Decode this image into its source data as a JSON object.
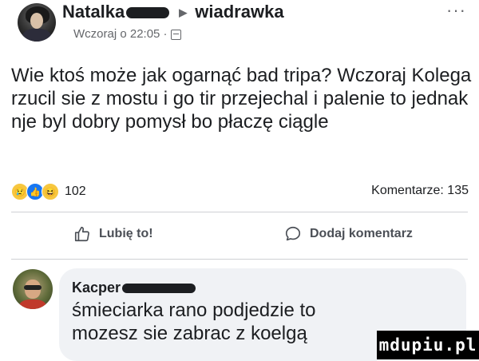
{
  "post": {
    "author": "Natalka",
    "group": "wiadrawka",
    "timestamp": "Wczoraj o 22:05 ·",
    "more_label": "···",
    "text": "Wie ktoś może jak ogarnąć bad tripa? Wczoraj Kolega rzucil sie z mostu i go tir przejechal i palenie to jednak nje byl dobry pomysł bo płaczę ciągle",
    "reaction_count": "102",
    "comments_count": "Komentarze: 135"
  },
  "actions": {
    "like_label": "Lubię to!",
    "comment_label": "Dodaj komentarz"
  },
  "comment": {
    "author": "Kacper",
    "text": "śmieciarka rano podjedzie to mozesz sie zabrac z koelgą"
  },
  "watermark": "mdupiu.pl",
  "icons": [
    "avatar",
    "arrow-right-icon",
    "audience-icon",
    "more-icon",
    "sad-reaction-icon",
    "like-reaction-icon",
    "laugh-reaction-icon",
    "thumb-up-icon",
    "comment-bubble-icon"
  ],
  "colors": {
    "muted": "#65676b",
    "like_blue": "#1877f2",
    "comment_bg": "#f0f2f5",
    "divider": "#ced0d4"
  }
}
